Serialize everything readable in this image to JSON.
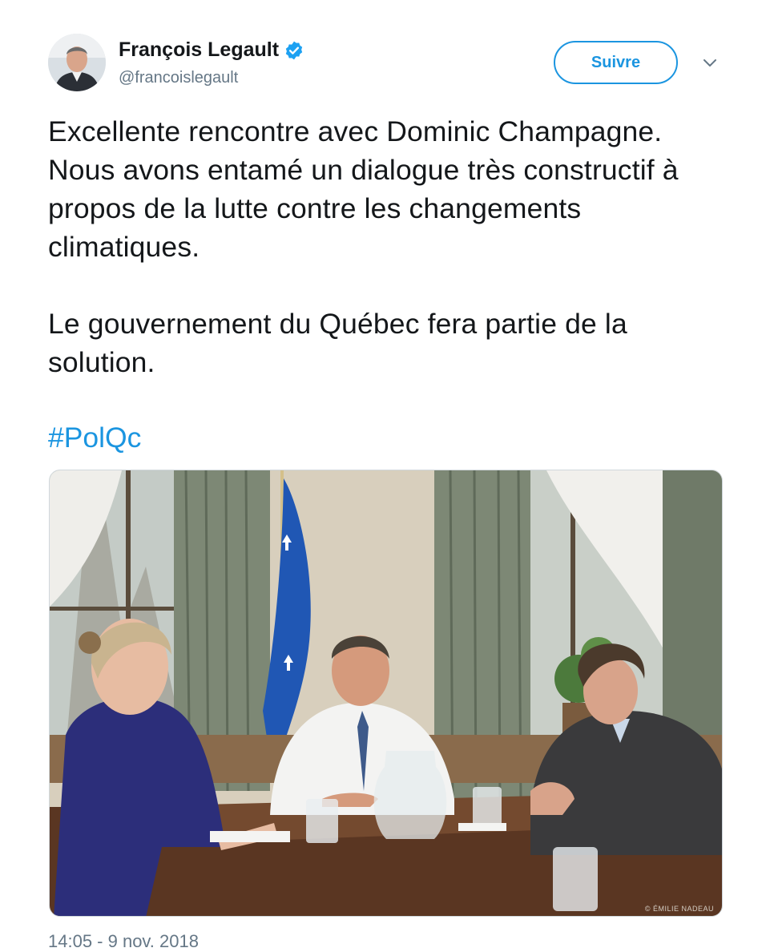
{
  "tweet": {
    "author": {
      "name": "François Legault",
      "handle": "@francoislegault",
      "verified": true
    },
    "follow_label": "Suivre",
    "text_paragraphs": [
      "Excellente rencontre avec Dominic Champagne. Nous avons entamé un dialogue très constructif à propos de la lutte contre les changements climatiques.",
      "Le gouvernement du Québec fera partie de la solution."
    ],
    "hashtag": "#PolQc",
    "photo_credit": "© ÉMILIE NADEAU",
    "timestamp": "14:05 - 9 nov. 2018"
  },
  "colors": {
    "accent": "#1b95e0",
    "text": "#14171a",
    "secondary_text": "#657786"
  },
  "icons": {
    "verified": "verified-badge-icon",
    "caret": "chevron-down-icon"
  }
}
